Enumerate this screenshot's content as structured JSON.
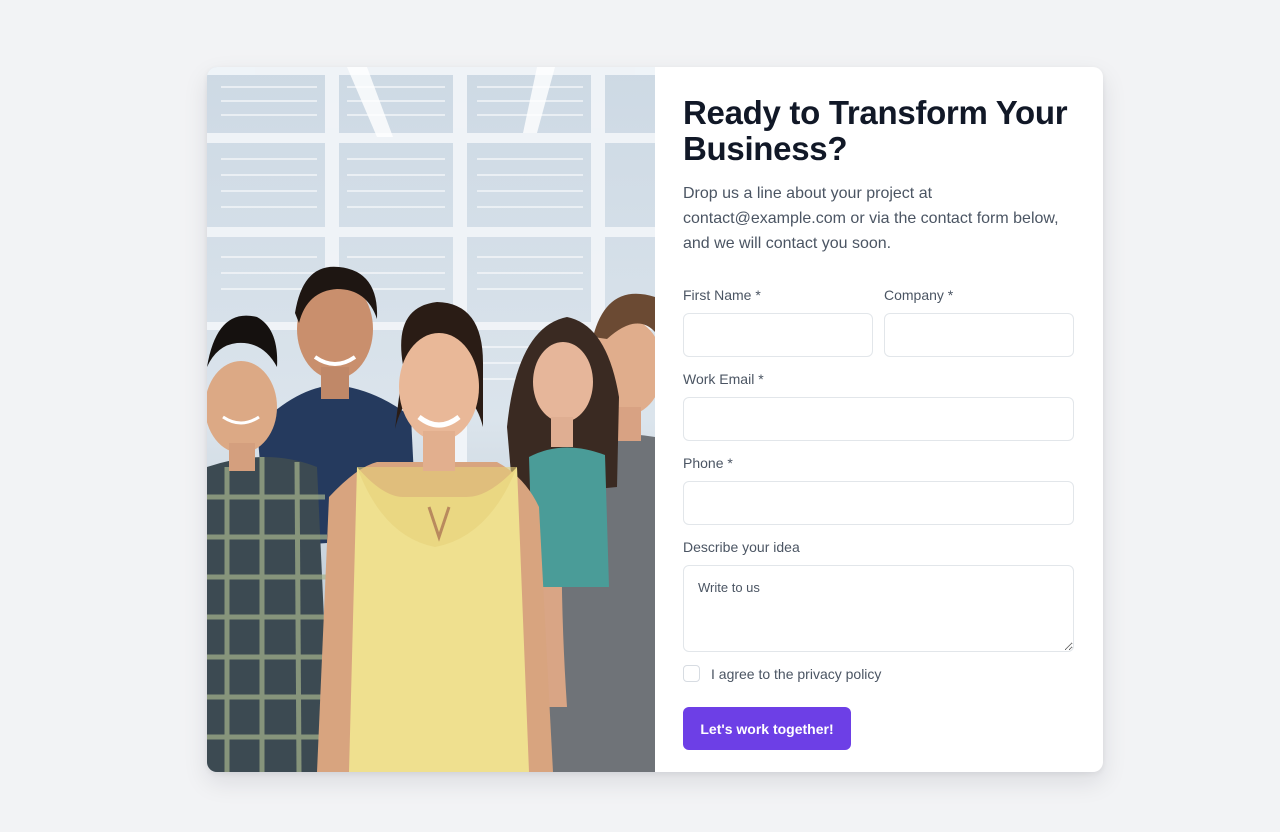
{
  "photo": {
    "alt": "Group of five smiling young professionals standing together in a bright office"
  },
  "heading": "Ready to Transform Your Business?",
  "intro": "Drop us a line about your project at contact@example.com or via the contact form below, and we will contact you soon.",
  "form": {
    "first_name": {
      "label": "First Name *",
      "value": "",
      "placeholder": ""
    },
    "company": {
      "label": "Company *",
      "value": "",
      "placeholder": ""
    },
    "work_email": {
      "label": "Work Email *",
      "value": "",
      "placeholder": ""
    },
    "phone": {
      "label": "Phone *",
      "value": "",
      "placeholder": ""
    },
    "idea": {
      "label": "Describe your idea",
      "value": "",
      "placeholder": "Write to us"
    },
    "agree": {
      "label": "I agree to the privacy policy",
      "checked": false
    },
    "submit_label": "Let's work together!"
  },
  "colors": {
    "page_background": "#f2f3f5",
    "accent": "#6d3fe6",
    "heading": "#111827",
    "text": "#4b5563",
    "border": "#e2e6ea"
  }
}
